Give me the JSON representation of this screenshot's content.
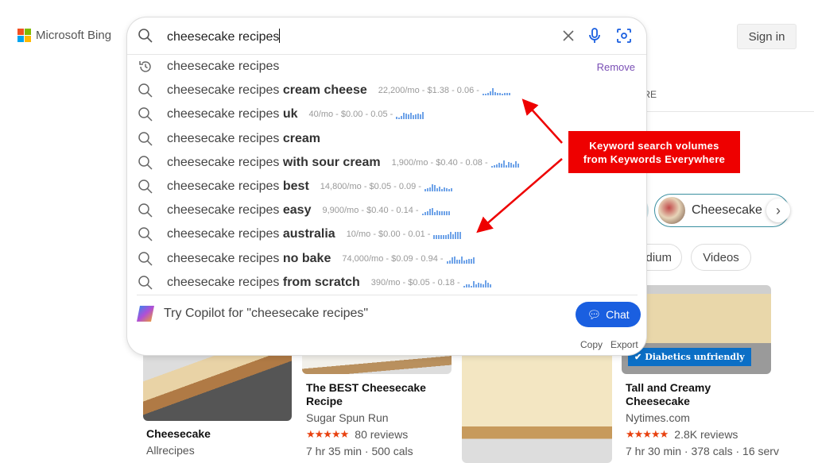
{
  "header": {
    "logo_text": "Microsoft Bing",
    "sign_in": "Sign in",
    "tab_more": "ORE"
  },
  "search": {
    "query": "cheesecake recipes"
  },
  "suggestions": [
    {
      "type": "history",
      "prefix": "cheesecake recipes",
      "bold": "",
      "remove": "Remove"
    },
    {
      "type": "search",
      "prefix": "cheesecake recipes ",
      "bold": "cream cheese",
      "metrics": "22,200/mo - $1.38 - 0.06 -",
      "trend": [
        2,
        2,
        3,
        5,
        9,
        4,
        3,
        3,
        2,
        3,
        3,
        3
      ]
    },
    {
      "type": "search",
      "prefix": "cheesecake recipes ",
      "bold": "uk",
      "metrics": "40/mo - $0.00 - 0.05 -",
      "trend": [
        3,
        2,
        4,
        8,
        7,
        6,
        8,
        5,
        6,
        7,
        6,
        9
      ]
    },
    {
      "type": "search",
      "prefix": "cheesecake recipes ",
      "bold": "cream",
      "metrics": ""
    },
    {
      "type": "search",
      "prefix": "cheesecake recipes ",
      "bold": "with sour cream",
      "metrics": "1,900/mo - $0.40 - 0.08 -",
      "trend": [
        2,
        3,
        4,
        6,
        5,
        9,
        3,
        7,
        6,
        4,
        8,
        5
      ]
    },
    {
      "type": "search",
      "prefix": "cheesecake recipes ",
      "bold": "best",
      "metrics": "14,800/mo - $0.05 - 0.09 -",
      "trend": [
        3,
        4,
        5,
        9,
        8,
        4,
        6,
        3,
        5,
        4,
        3,
        4
      ]
    },
    {
      "type": "search",
      "prefix": "cheesecake recipes ",
      "bold": "easy",
      "metrics": "9,900/mo - $0.40 - 0.14 -",
      "trend": [
        2,
        4,
        5,
        8,
        9,
        4,
        6,
        5,
        5,
        5,
        5,
        5
      ]
    },
    {
      "type": "search",
      "prefix": "cheesecake recipes ",
      "bold": "australia",
      "metrics": "10/mo - $0.00 - 0.01 -",
      "trend": [
        5,
        5,
        5,
        5,
        5,
        5,
        6,
        9,
        6,
        9,
        9,
        9
      ]
    },
    {
      "type": "search",
      "prefix": "cheesecake recipes ",
      "bold": "no bake",
      "metrics": "74,000/mo - $0.09 - 0.94 -",
      "trend": [
        3,
        4,
        8,
        9,
        5,
        5,
        9,
        4,
        5,
        6,
        6,
        8
      ]
    },
    {
      "type": "search",
      "prefix": "cheesecake recipes ",
      "bold": "from scratch",
      "metrics": "390/mo - $0.05 - 0.18 -",
      "trend": [
        2,
        4,
        4,
        2,
        8,
        4,
        6,
        5,
        4,
        9,
        6,
        4
      ]
    }
  ],
  "copilot": {
    "text": "Try Copilot for \"cheesecake recipes\"",
    "chat": "Chat",
    "copy": "Copy",
    "export": "Export"
  },
  "chips": {
    "entity": "Cheesecake",
    "pill1": "dium",
    "pill2": "Videos"
  },
  "cards": [
    {
      "title": "Cheesecake",
      "source": "Allrecipes"
    },
    {
      "title": "The BEST Cheesecake Recipe",
      "source": "Sugar Spun Run",
      "stars": "★★★★★",
      "reviews": "80 reviews",
      "meta": "7 hr 35 min · 500 cals"
    },
    {
      "title": "",
      "source": ""
    },
    {
      "title": "Tall and Creamy Cheesecake",
      "source": "Nytimes.com",
      "stars": "★★★★★",
      "reviews": "2.8K reviews",
      "meta": "7 hr 30 min · 378 cals · 16 serv",
      "badge": "Diabetics unfriendly"
    }
  ],
  "annotation": {
    "text_line1": "Keyword search volumes",
    "text_line2": "from Keywords Everywhere"
  },
  "colors": {
    "accent": "#1a5fe0",
    "history": "#7a4fb5",
    "annotation": "#ee0000",
    "spark": "#6fa3e8",
    "stars": "#e8410f"
  }
}
